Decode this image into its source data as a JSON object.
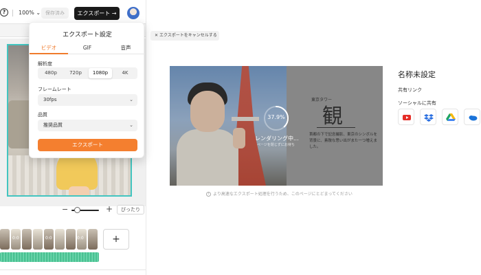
{
  "toolbar": {
    "help_icon": "?",
    "zoom": "100%",
    "saved_label": "保存済み",
    "export_label": "エクスポート"
  },
  "export_popup": {
    "title": "エクスポート設定",
    "tabs": [
      {
        "label": "ビデオ",
        "active": true
      },
      {
        "label": "GIF",
        "active": false
      },
      {
        "label": "音声",
        "active": false
      }
    ],
    "resolution_label": "解析度",
    "resolutions": [
      {
        "label": "480p",
        "active": false
      },
      {
        "label": "720p",
        "active": false
      },
      {
        "label": "1080p",
        "active": true
      },
      {
        "label": "4K",
        "active": false
      }
    ],
    "framerate_label": "フレームレート",
    "framerate_value": "30fps",
    "quality_label": "品質",
    "quality_value": "推奨品質",
    "export_button": "エクスポート",
    "accent_color": "#f47f2f"
  },
  "canvas": {
    "fit_label": "ぴったり",
    "zoom_minus": "−",
    "zoom_plus": "+",
    "add_clip": "+",
    "clip_labels": [
      "0:0",
      "0:0",
      "0:0"
    ]
  },
  "preview": {
    "cancel_label": "エクスポートをキャンセルする",
    "progress": "37.9%",
    "progress_fraction": 0.379,
    "rendering_text": "レンダリング中...",
    "rendering_sub": "ページを閉じずにお待ち",
    "poster_small": "東京タワー",
    "poster_kanji": "観",
    "poster_text": "首都の下で記念撮影、東京のシンボルを背景に、素敵な思い出がまた一つ増えました。",
    "hint": "より高速なエクスポート処理を行うため、このページにとどまってください"
  },
  "share": {
    "video_title": "名称未設定",
    "share_link_label": "共有リンク",
    "social_label": "ソーシャルに共有",
    "social_icons": [
      "youtube-icon",
      "dropbox-icon",
      "google-drive-icon",
      "onedrive-icon"
    ]
  }
}
